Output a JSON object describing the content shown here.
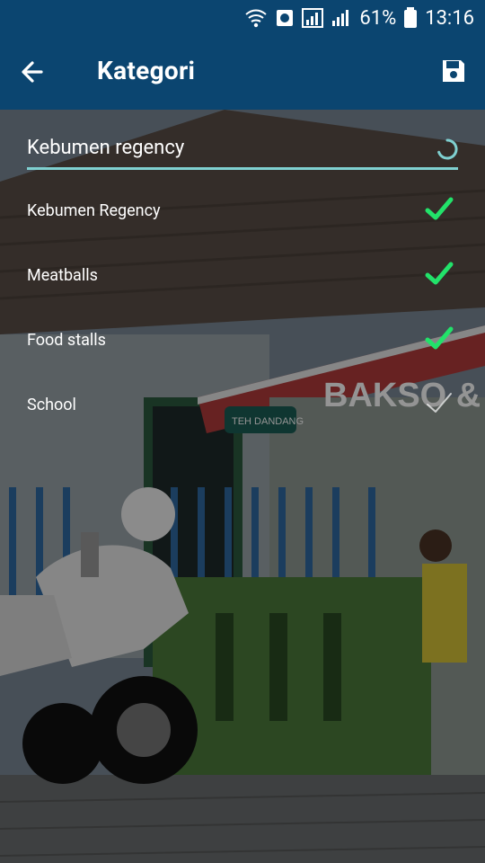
{
  "status_bar": {
    "battery_percent": "61%",
    "time": "13:16"
  },
  "app_bar": {
    "title": "Kategori"
  },
  "search": {
    "value": "Kebumen regency"
  },
  "categories": [
    {
      "label": "Kebumen Regency",
      "checked": true
    },
    {
      "label": "Meatballs",
      "checked": true
    },
    {
      "label": "Food stalls",
      "checked": true
    },
    {
      "label": "School",
      "checked": false
    }
  ],
  "photo_sign": {
    "text": "BAKSO &",
    "small_sign": "TEH DANDANG"
  },
  "colors": {
    "app_bar": "#0b4570",
    "accent": "#7fd0d0",
    "check": "#22e26a"
  }
}
